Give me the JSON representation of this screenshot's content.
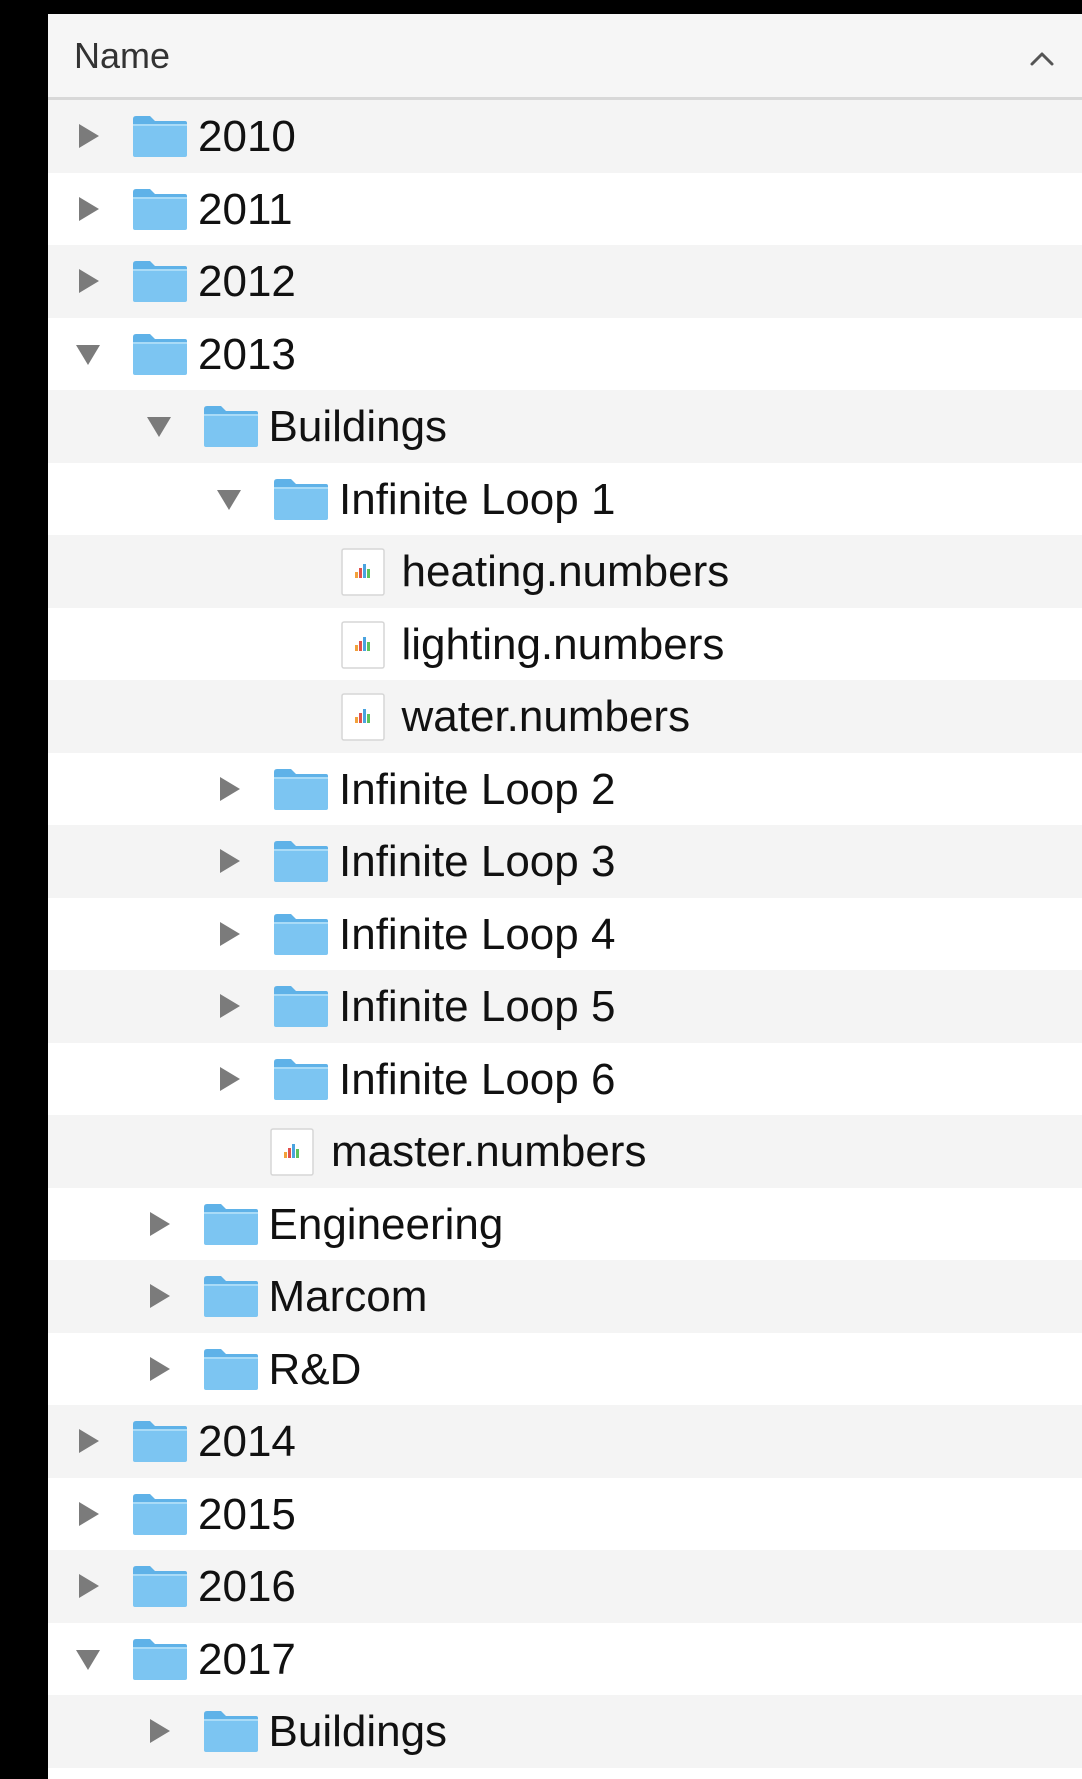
{
  "column_header": {
    "label": "Name",
    "sort_icon": "chevron-up-icon"
  },
  "colors": {
    "folder": "#7cc5f2",
    "folder_tab": "#5fb2e8",
    "row_alt": "#f4f4f4",
    "disclosure": "#7b7b7b"
  },
  "rows": [
    {
      "label": "2010",
      "kind": "folder",
      "depth": 0,
      "expanded": false
    },
    {
      "label": "2011",
      "kind": "folder",
      "depth": 0,
      "expanded": false
    },
    {
      "label": "2012",
      "kind": "folder",
      "depth": 0,
      "expanded": false
    },
    {
      "label": "2013",
      "kind": "folder",
      "depth": 0,
      "expanded": true
    },
    {
      "label": "Buildings",
      "kind": "folder",
      "depth": 1,
      "expanded": true
    },
    {
      "label": "Infinite Loop 1",
      "kind": "folder",
      "depth": 2,
      "expanded": true
    },
    {
      "label": "heating.numbers",
      "kind": "file",
      "depth": 3
    },
    {
      "label": "lighting.numbers",
      "kind": "file",
      "depth": 3
    },
    {
      "label": "water.numbers",
      "kind": "file",
      "depth": 3
    },
    {
      "label": "Infinite Loop 2",
      "kind": "folder",
      "depth": 2,
      "expanded": false
    },
    {
      "label": "Infinite Loop 3",
      "kind": "folder",
      "depth": 2,
      "expanded": false
    },
    {
      "label": "Infinite Loop 4",
      "kind": "folder",
      "depth": 2,
      "expanded": false
    },
    {
      "label": "Infinite Loop 5",
      "kind": "folder",
      "depth": 2,
      "expanded": false
    },
    {
      "label": "Infinite Loop 6",
      "kind": "folder",
      "depth": 2,
      "expanded": false
    },
    {
      "label": "master.numbers",
      "kind": "file",
      "depth": 2
    },
    {
      "label": "Engineering",
      "kind": "folder",
      "depth": 1,
      "expanded": false
    },
    {
      "label": "Marcom",
      "kind": "folder",
      "depth": 1,
      "expanded": false
    },
    {
      "label": "R&D",
      "kind": "folder",
      "depth": 1,
      "expanded": false
    },
    {
      "label": "2014",
      "kind": "folder",
      "depth": 0,
      "expanded": false
    },
    {
      "label": "2015",
      "kind": "folder",
      "depth": 0,
      "expanded": false
    },
    {
      "label": "2016",
      "kind": "folder",
      "depth": 0,
      "expanded": false
    },
    {
      "label": "2017",
      "kind": "folder",
      "depth": 0,
      "expanded": true
    },
    {
      "label": "Buildings",
      "kind": "folder",
      "depth": 1,
      "expanded": false
    }
  ]
}
